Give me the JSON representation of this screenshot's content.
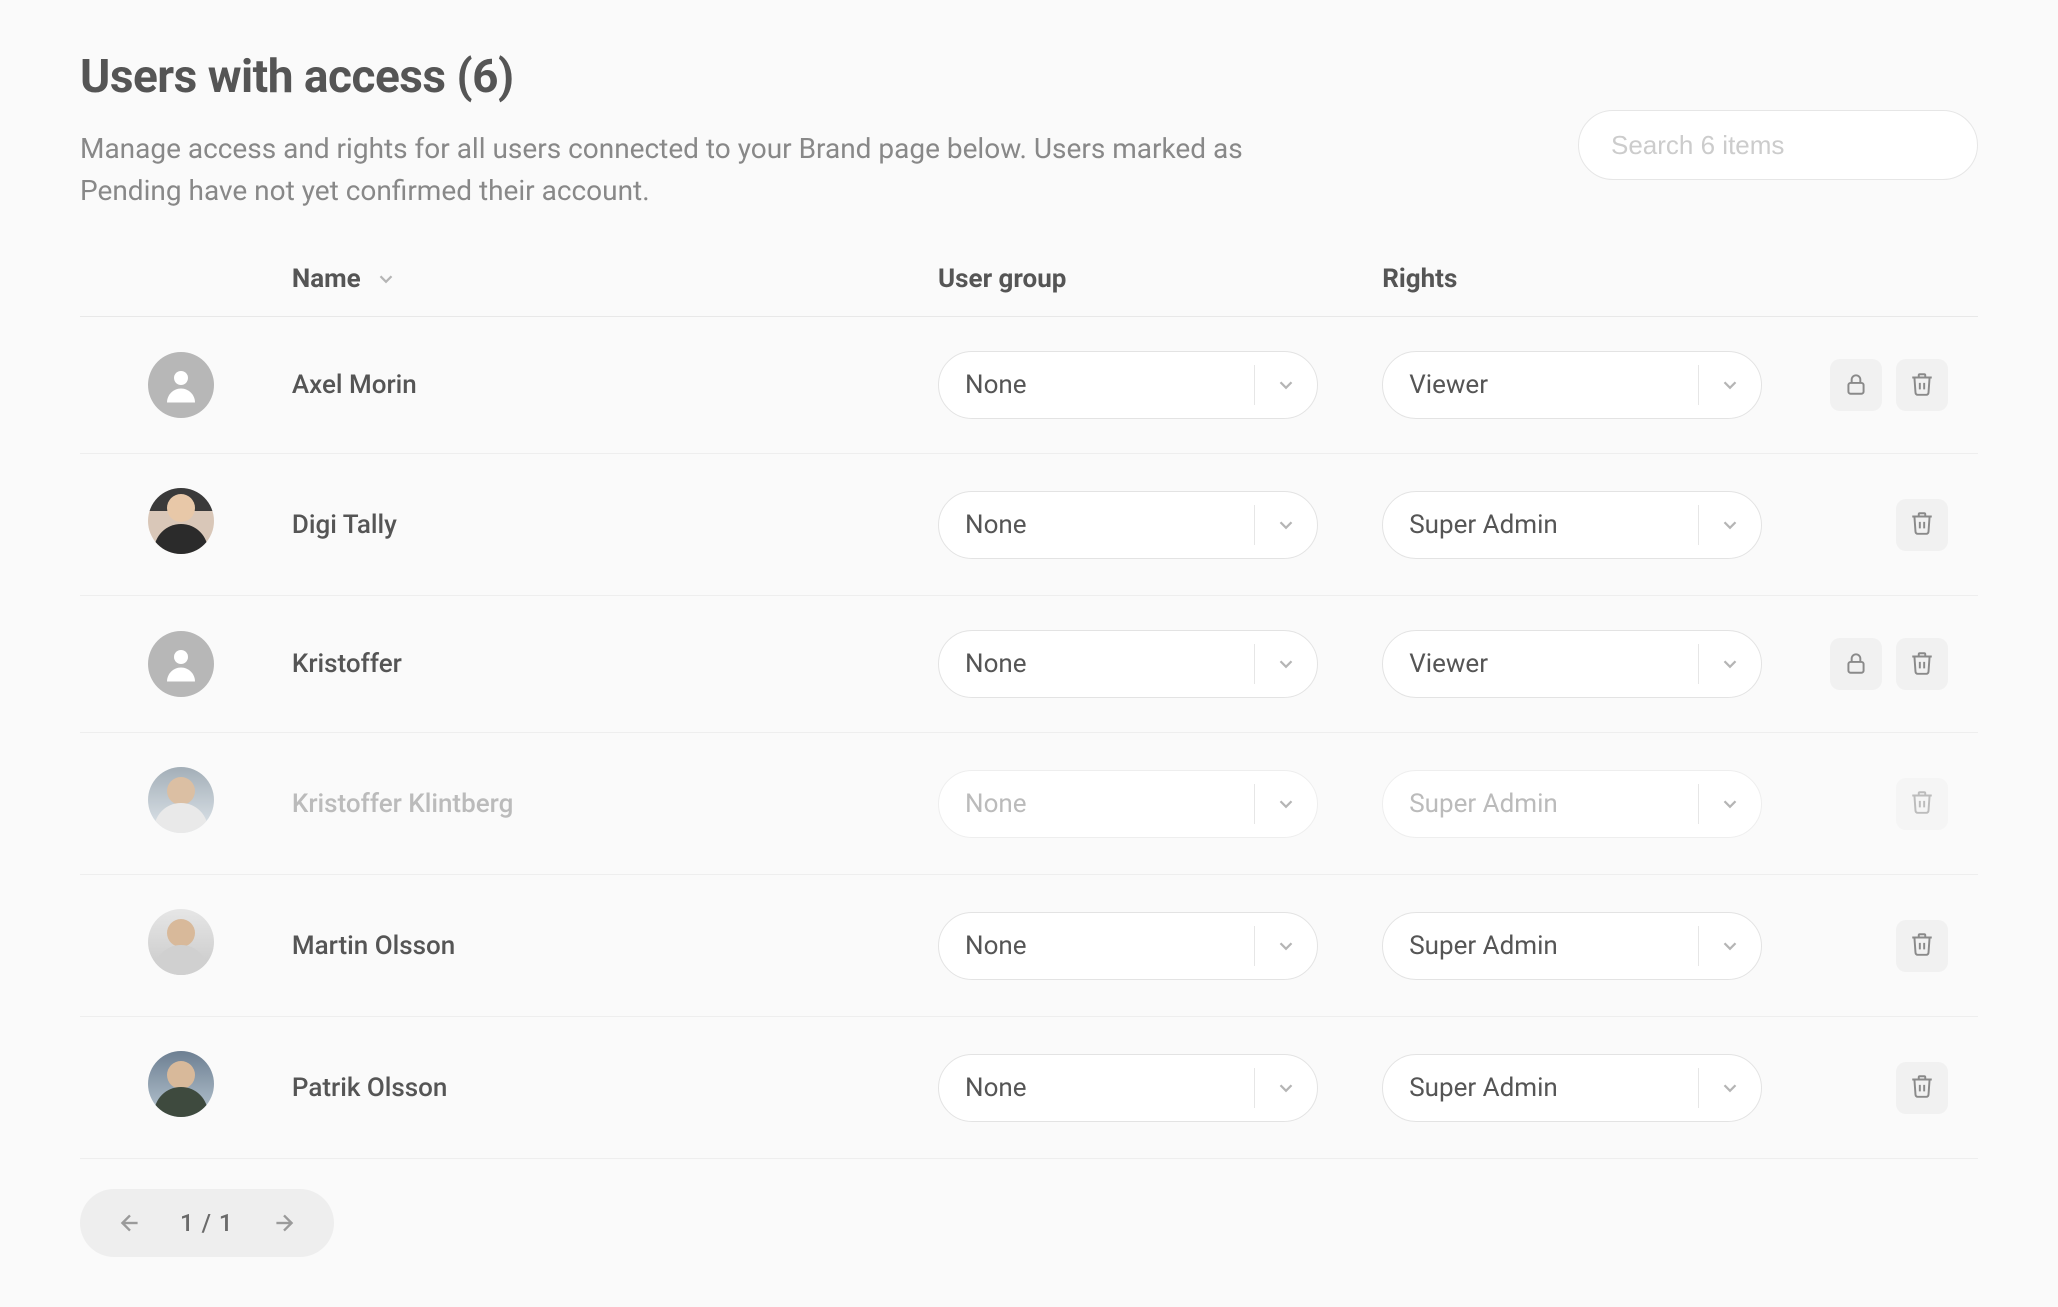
{
  "header": {
    "title": "Users with access (6)",
    "subtitle": "Manage access and rights for all users connected to your Brand page below. Users marked as Pending have not yet confirmed their account."
  },
  "search": {
    "placeholder": "Search 6 items"
  },
  "columns": {
    "name": "Name",
    "group": "User group",
    "rights": "Rights"
  },
  "users": [
    {
      "name": "Axel Morin",
      "group": "None",
      "rights": "Viewer",
      "avatar": "placeholder",
      "lock": true,
      "delete": true,
      "disabled": false
    },
    {
      "name": "Digi Tally",
      "group": "None",
      "rights": "Super Admin",
      "avatar": "a1",
      "lock": false,
      "delete": true,
      "disabled": false
    },
    {
      "name": "Kristoffer",
      "group": "None",
      "rights": "Viewer",
      "avatar": "placeholder",
      "lock": true,
      "delete": true,
      "disabled": false
    },
    {
      "name": "Kristoffer Klintberg",
      "group": "None",
      "rights": "Super Admin",
      "avatar": "a2",
      "lock": false,
      "delete": true,
      "disabled": true
    },
    {
      "name": "Martin Olsson",
      "group": "None",
      "rights": "Super Admin",
      "avatar": "a3",
      "lock": false,
      "delete": true,
      "disabled": false
    },
    {
      "name": "Patrik Olsson",
      "group": "None",
      "rights": "Super Admin",
      "avatar": "a4",
      "lock": false,
      "delete": true,
      "disabled": false
    }
  ],
  "pagination": {
    "label": "1 / 1"
  }
}
